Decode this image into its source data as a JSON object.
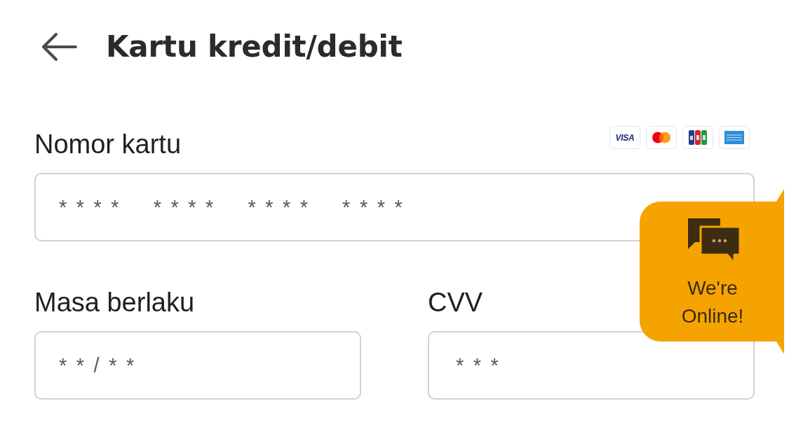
{
  "header": {
    "title": "Kartu kredit/debit"
  },
  "card_number": {
    "label": "Nomor kartu",
    "placeholder": "**** **** **** ****",
    "card_brands": [
      {
        "kind": "visa",
        "label": "VISA"
      },
      {
        "kind": "mastercard"
      },
      {
        "kind": "jcb"
      },
      {
        "kind": "amex"
      }
    ]
  },
  "expiry": {
    "label": "Masa berlaku",
    "placeholder": "**/**"
  },
  "cvv": {
    "label": "CVV",
    "placeholder": "***"
  },
  "chat_widget": {
    "label": "We're Online!"
  }
}
